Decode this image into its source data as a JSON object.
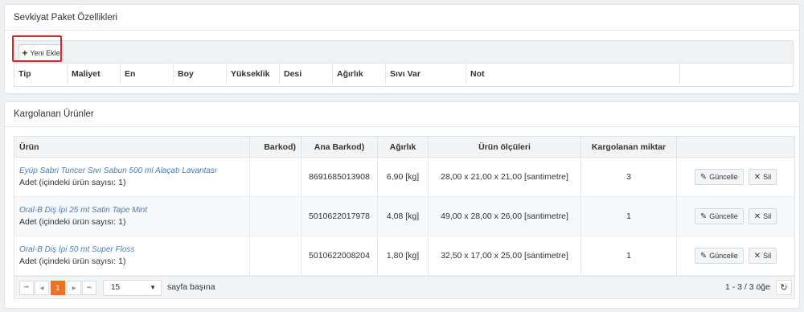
{
  "panel1": {
    "title": "Sevkiyat Paket Özellikleri",
    "add_button": {
      "icon": "plus-icon",
      "label": "Yeni Ekle"
    },
    "columns": [
      "Tip",
      "Maliyet",
      "En",
      "Boy",
      "Yükseklik",
      "Desi",
      "Ağırlık",
      "Sıvı Var",
      "Not",
      ""
    ]
  },
  "panel2": {
    "title": "Kargolanan Ürünler",
    "columns": [
      "Ürün",
      "Barkod)",
      "Ana Barkod)",
      "Ağırlık",
      "Ürün ölçüleri",
      "Kargolanan miktar",
      ""
    ],
    "rows": [
      {
        "name": "Eyüp Sabri Tuncer Sıvı Sabun 500 ml Alaçatı Lavantası",
        "unit": "Adet (içindeki ürün sayısı: 1)",
        "barkod": "",
        "ana_barkod": "8691685013908",
        "agirlik": "6,90 [kg]",
        "olculer": "28,00 x 21,00 x 21,00 [santimetre]",
        "miktar": "3"
      },
      {
        "name": "Oral-B Diş İpi 25 mt Satin Tape Mint",
        "unit": "Adet (içindeki ürün sayısı: 1)",
        "barkod": "",
        "ana_barkod": "5010622017978",
        "agirlik": "4,08 [kg]",
        "olculer": "49,00 x 28,00 x 26,00 [santimetre]",
        "miktar": "1"
      },
      {
        "name": "Oral-B Diş İpi 50 mt Super Floss",
        "unit": "Adet (içindeki ürün sayısı: 1)",
        "barkod": "",
        "ana_barkod": "5010622008204",
        "agirlik": "1,80 [kg]",
        "olculer": "32,50 x 17,00 x 25,00 [santimetre]",
        "miktar": "1"
      }
    ],
    "actions": {
      "update_label": "Güncelle",
      "update_icon": "pencil-icon",
      "delete_label": "Sil",
      "delete_icon": "close-icon"
    },
    "pager": {
      "first": "⏮",
      "prev": "◀",
      "current_page": "1",
      "next": "▶",
      "last": "⏭",
      "page_size": "15",
      "page_size_label": "sayfa başına",
      "info": "1 - 3 / 3 öğe",
      "refresh_icon": "refresh-icon"
    },
    "colors": {
      "accent": "#f36f21",
      "link": "#4a7fb5",
      "highlight": "#d9262b"
    }
  }
}
